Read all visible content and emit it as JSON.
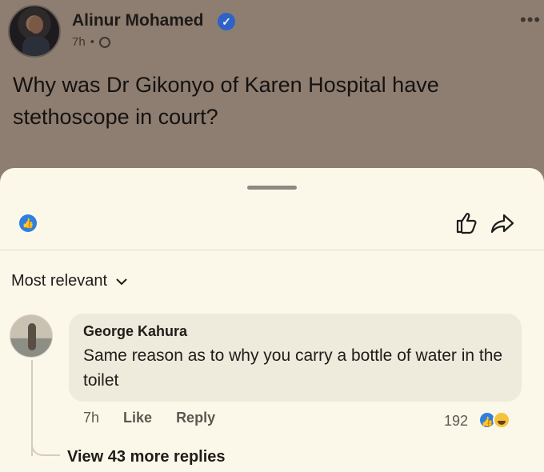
{
  "post": {
    "author": "Alinur Mohamed",
    "time": "7h",
    "separator": "•",
    "text": "Why was Dr Gikonyo of Karen Hospital have stethoscope in court?",
    "more_icon": "ellipsis-icon",
    "verified_icon": "verified-badge-icon",
    "privacy_icon": "globe-icon"
  },
  "sheet": {
    "sort_label": "Most relevant",
    "like_icon": "like-reaction-icon",
    "action_icons": [
      "thumbs-up-icon",
      "share-arrow-icon"
    ]
  },
  "comment": {
    "author": "George Kahura",
    "text": "Same reason as to why you carry a bottle of water in the toilet",
    "time": "7h",
    "like_label": "Like",
    "reply_label": "Reply",
    "reaction_count": "192",
    "reactions": [
      "like",
      "haha"
    ],
    "view_more_label": "View 43 more replies"
  },
  "colors": {
    "sheet_bg": "#fbf8ea",
    "dim_bg": "#8e7e71",
    "bubble_bg": "#eeeadc",
    "accent_blue": "#2f7fe0"
  }
}
